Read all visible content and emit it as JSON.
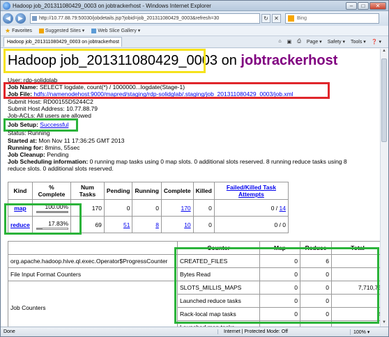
{
  "window": {
    "title": "Hadoop job_201311080429_0003 on jobtrackerhost - Windows Internet Explorer",
    "address": "http://10.77.88.79:50030/jobdetails.jsp?jobid=job_201311080429_0003&refresh=30",
    "search_placeholder": "Bing",
    "minimize": "–",
    "maximize": "□",
    "close": "✕"
  },
  "favorites": {
    "label": "Favorites",
    "items": [
      "Suggested Sites ▾",
      "Web Slice Gallery ▾"
    ]
  },
  "tab": {
    "label": "Hadoop job_201311080429_0003 on jobtrackerhost"
  },
  "toolbar": {
    "page": "Page ▾",
    "safety": "Safety ▾",
    "tools": "Tools ▾",
    "help": "❓ ▾"
  },
  "page": {
    "title_prefix": "Hadoop job_201311080429_0003",
    "title_on": "on",
    "title_host": "jobtrackerhost",
    "user": "User: rdp-solidglab",
    "job_name_label": "Job Name:",
    "job_name": "SELECT logdate, count(*) / 1000000...logdate(Stage-1)",
    "job_file_label": "Job File:",
    "job_file": "hdfs://namenodehost:9000/mapred/staging/rdp-solidglab/.staging/job_201311080429_0003/job.xml",
    "submit_host": "Submit Host: RD00155D5244C2",
    "submit_addr": "Submit Host Address: 10.77.88.79",
    "acls": "Job-ACLs: All users are allowed",
    "setup_label": "Job Setup:",
    "setup": "Successful",
    "status": "Status: Running",
    "started_label": "Started at:",
    "started": "Mon Nov 11 17:36:25 GMT 2013",
    "running_label": "Running for:",
    "running": "8mins, 55sec",
    "cleanup_label": "Job Cleanup:",
    "cleanup": "Pending",
    "sched_label": "Job Scheduling information:",
    "sched_line1": "0 running map tasks using 0 map slots. 0 additional slots reserved. 8 running reduce tasks using 8",
    "sched_line2": "reduce slots. 0 additional slots reserved."
  },
  "kind_table": {
    "headers": [
      "Kind",
      "% Complete",
      "Num Tasks",
      "Pending",
      "Running",
      "Complete",
      "Killed",
      "Failed/Killed Task Attempts"
    ],
    "rows": [
      {
        "kind": "map",
        "pct": "100.00%",
        "pct_value": 100,
        "num": "170",
        "pending": "0",
        "running": "0",
        "complete": "170",
        "killed": "0",
        "failed": "0 / ",
        "failed_link": "14"
      },
      {
        "kind": "reduce",
        "pct": "17.83%",
        "pct_value": 17.83,
        "num": "69",
        "pending": "51",
        "running": "8",
        "complete": "10",
        "killed": "0",
        "failed": "0 / 0",
        "failed_link": ""
      }
    ]
  },
  "counter_table": {
    "headers": [
      "",
      "Counter",
      "Map",
      "Reduce",
      "Total"
    ],
    "rows": [
      {
        "group": "org.apache.hadoop.hive.ql.exec.Operator$ProgressCounter",
        "counter": "CREATED_FILES",
        "map": "0",
        "reduce": "6",
        "total": ""
      },
      {
        "group": "File Input Format Counters",
        "counter": "Bytes Read",
        "map": "0",
        "reduce": "0",
        "total": ""
      },
      {
        "group": "",
        "counter": "SLOTS_MILLIS_MAPS",
        "map": "0",
        "reduce": "0",
        "total": "7,710,75"
      },
      {
        "group": "",
        "counter": "Launched reduce tasks",
        "map": "0",
        "reduce": "0",
        "total": "'"
      },
      {
        "group": "Job Counters",
        "counter": "Rack-local map tasks",
        "map": "0",
        "reduce": "0",
        "total": "4"
      },
      {
        "group": "",
        "counter": "Launched map tasks",
        "map": "",
        "reduce": "",
        "total": ""
      }
    ]
  },
  "status_bar": {
    "done": "Done",
    "zone": "Internet | Protected Mode: Off",
    "zoom": "100% ▾"
  },
  "highlight_colors": {
    "yellow": "#f5e21c",
    "red": "#e0262b",
    "green": "#2bb33a"
  }
}
